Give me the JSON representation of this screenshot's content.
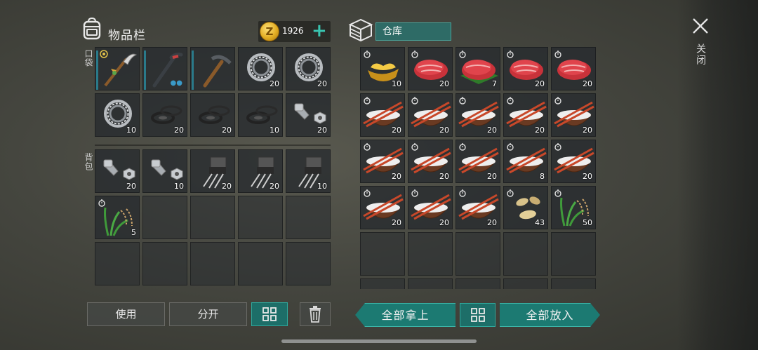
{
  "inventory": {
    "title": "物品栏",
    "coins": "1926",
    "pocket_label": "口袋",
    "backpack_label": "背包",
    "pocket_slots": [
      {
        "item": "scythe",
        "qty": "",
        "durability": true,
        "badge": true
      },
      {
        "item": "crowbar",
        "qty": "",
        "durability": true,
        "dots": true
      },
      {
        "item": "pickaxe",
        "qty": "",
        "durability": true
      },
      {
        "item": "bearing",
        "qty": "20"
      },
      {
        "item": "bearing",
        "qty": "20"
      },
      {
        "item": "bearing",
        "qty": "10"
      },
      {
        "item": "rubber-gasket",
        "qty": "20"
      },
      {
        "item": "rubber-gasket",
        "qty": "20"
      },
      {
        "item": "rubber-gasket",
        "qty": "10"
      },
      {
        "item": "bolt-nut",
        "qty": "20"
      }
    ],
    "backpack_slots": [
      {
        "item": "bolt-nut",
        "qty": "20"
      },
      {
        "item": "bolt-nut",
        "qty": "10"
      },
      {
        "item": "transistor",
        "qty": "20"
      },
      {
        "item": "transistor",
        "qty": "20"
      },
      {
        "item": "transistor",
        "qty": "10"
      },
      {
        "item": "rice-plant",
        "qty": "5",
        "timer": true
      },
      {
        "item": "",
        "qty": ""
      },
      {
        "item": "",
        "qty": ""
      },
      {
        "item": "",
        "qty": ""
      },
      {
        "item": "",
        "qty": ""
      },
      {
        "item": "",
        "qty": ""
      },
      {
        "item": "",
        "qty": ""
      },
      {
        "item": "",
        "qty": ""
      },
      {
        "item": "",
        "qty": ""
      },
      {
        "item": "",
        "qty": ""
      }
    ],
    "buttons": {
      "use": "使用",
      "split": "分开"
    }
  },
  "warehouse": {
    "title": "仓库",
    "slots": [
      {
        "item": "gold-ingot",
        "qty": "10",
        "timer": true
      },
      {
        "item": "raw-meat",
        "qty": "20",
        "timer": true
      },
      {
        "item": "raw-meat-leaf",
        "qty": "7",
        "timer": true
      },
      {
        "item": "raw-meat",
        "qty": "20",
        "timer": true
      },
      {
        "item": "raw-meat",
        "qty": "20",
        "timer": true
      },
      {
        "item": "rice-bowl",
        "qty": "20",
        "timer": true
      },
      {
        "item": "rice-bowl",
        "qty": "20",
        "timer": true
      },
      {
        "item": "rice-bowl",
        "qty": "20",
        "timer": true
      },
      {
        "item": "rice-bowl",
        "qty": "20",
        "timer": true
      },
      {
        "item": "rice-bowl",
        "qty": "20",
        "timer": true
      },
      {
        "item": "rice-bowl",
        "qty": "20",
        "timer": true
      },
      {
        "item": "rice-bowl",
        "qty": "20",
        "timer": true
      },
      {
        "item": "rice-bowl",
        "qty": "20",
        "timer": true
      },
      {
        "item": "rice-bowl",
        "qty": "8",
        "timer": true
      },
      {
        "item": "rice-bowl",
        "qty": "20",
        "timer": true
      },
      {
        "item": "rice-bowl",
        "qty": "20",
        "timer": true
      },
      {
        "item": "rice-bowl",
        "qty": "20",
        "timer": true
      },
      {
        "item": "rice-bowl",
        "qty": "20",
        "timer": true
      },
      {
        "item": "seeds",
        "qty": "43",
        "timer": true
      },
      {
        "item": "rice-plant",
        "qty": "50",
        "timer": true
      },
      {
        "item": "",
        "qty": ""
      },
      {
        "item": "",
        "qty": ""
      },
      {
        "item": "",
        "qty": ""
      },
      {
        "item": "",
        "qty": ""
      },
      {
        "item": "",
        "qty": ""
      },
      {
        "item": "",
        "qty": ""
      },
      {
        "item": "",
        "qty": ""
      },
      {
        "item": "",
        "qty": ""
      },
      {
        "item": "",
        "qty": ""
      },
      {
        "item": "",
        "qty": ""
      }
    ],
    "buttons": {
      "take_all": "全部拿上",
      "put_all": "全部放入"
    }
  },
  "close": {
    "label": "关闭"
  },
  "colors": {
    "accent_teal": "#1c7a72",
    "coin_gold": "#e2ad23",
    "plus_teal": "#39c4b0"
  }
}
